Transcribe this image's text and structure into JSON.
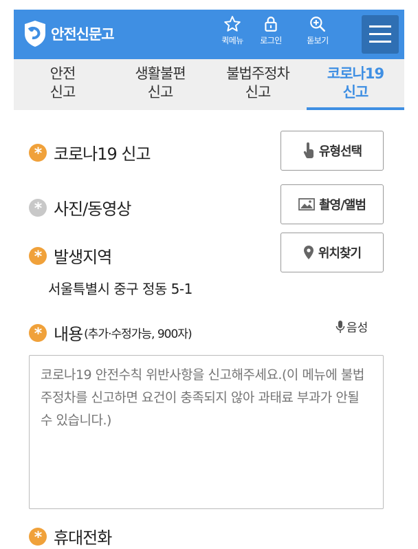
{
  "header": {
    "logo_text": "안전신문고",
    "quick_menu_label": "퀵메뉴",
    "login_label": "로그인",
    "zoom_label": "돋보기",
    "brand_color": "#3f8fe3"
  },
  "tabs": [
    {
      "line1": "안전",
      "line2": "신고",
      "active": false
    },
    {
      "line1": "생활불편",
      "line2": "신고",
      "active": false
    },
    {
      "line1": "불법주정차",
      "line2": "신고",
      "active": false
    },
    {
      "line1": "코로나19",
      "line2": "신고",
      "active": true
    }
  ],
  "form": {
    "type_label": "코로나19 신고",
    "type_button": "유형선택",
    "photo_label": "사진/동영상",
    "photo_button": "촬영/앨범",
    "location_label": "발생지역",
    "location_button": "위치찾기",
    "address": "서울특별시 중구 정동 5-1",
    "content_label": "내용",
    "content_sub": "(추가·수정가능, 900자)",
    "voice_label": "음성",
    "content_placeholder": "코로나19 안전수칙 위반사항을 신고해주세요.(이 메뉴에 불법주정차를 신고하면 요건이 충족되지 않아 과태료 부과가 안될 수 있습니다.)",
    "phone_label": "휴대전화"
  }
}
